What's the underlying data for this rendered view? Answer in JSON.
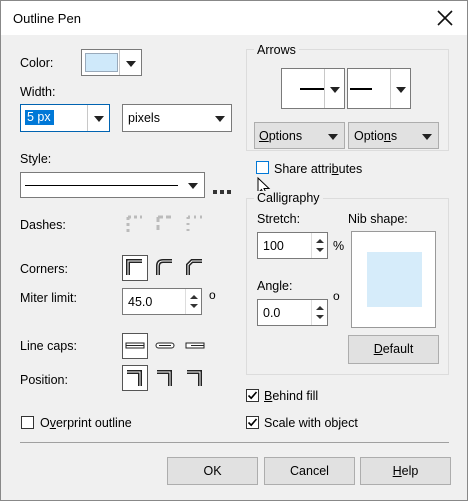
{
  "window": {
    "title": "Outline Pen"
  },
  "color": {
    "label": "Color:",
    "swatch": "#cfe9fa"
  },
  "width": {
    "label": "Width:",
    "value": "5 px",
    "unit": "pixels"
  },
  "style": {
    "label": "Style:"
  },
  "dashes": {
    "label": "Dashes:"
  },
  "corners": {
    "label": "Corners:"
  },
  "miter": {
    "label": "Miter limit:",
    "value": "45.0",
    "unit": "o"
  },
  "line_caps": {
    "label": "Line caps:"
  },
  "position": {
    "label": "Position:"
  },
  "overprint": {
    "label_pre": "O",
    "label_u": "v",
    "label_post": "erprint outline",
    "checked": false
  },
  "arrows": {
    "legend": "Arrows",
    "options1_pre": "",
    "options1_u": "O",
    "options1_post": "ptions",
    "options2_pre": "Optio",
    "options2_u": "n",
    "options2_post": "s",
    "share_pre": "Share attri",
    "share_u": "b",
    "share_post": "utes"
  },
  "calligraphy": {
    "legend": "Calligraphy",
    "stretch_label": "Stretch:",
    "stretch_value": "100",
    "stretch_unit": "%",
    "nib_label": "Nib shape:",
    "nib_color": "#d6ecfa",
    "angle_label": "Angle:",
    "angle_value": "0.0",
    "angle_unit": "o",
    "default_pre": "",
    "default_u": "D",
    "default_post": "efault"
  },
  "behind_fill": {
    "label_pre": "",
    "label_u": "B",
    "label_post": "ehind fill",
    "checked": true
  },
  "scale_with_object": {
    "label": "Scale with object",
    "checked": true
  },
  "footer": {
    "ok": "OK",
    "cancel": "Cancel",
    "help_u": "H",
    "help_post": "elp"
  }
}
